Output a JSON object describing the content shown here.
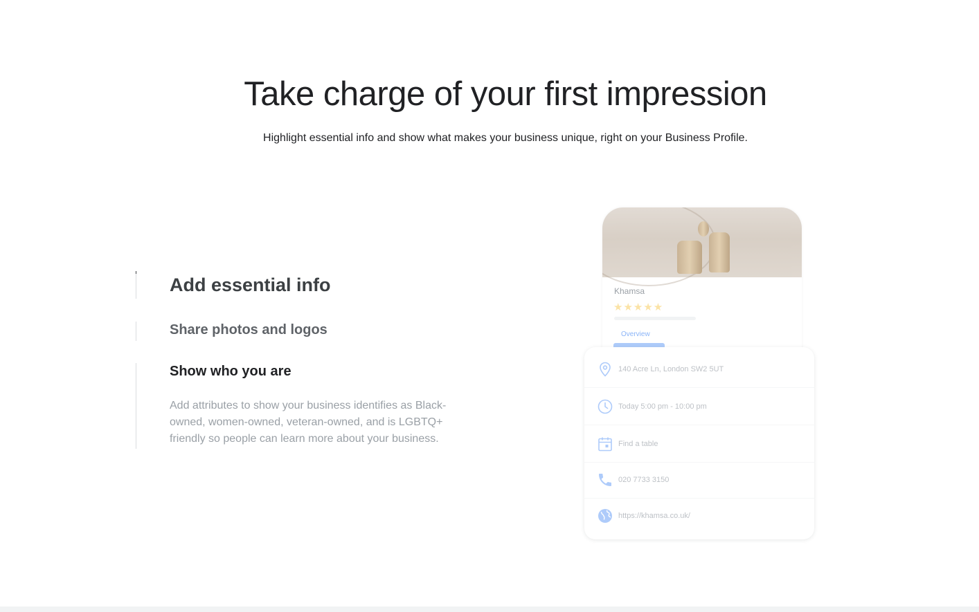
{
  "hero": {
    "title": "Take charge of your first impression",
    "subtitle": "Highlight essential info and show what makes your business unique, right on your Business Profile."
  },
  "features": [
    {
      "title": "Add essential info"
    },
    {
      "title": "Share photos and logos"
    },
    {
      "title": "Show who you are",
      "description": "Add attributes to show your business identifies as Black-owned, women-owned, veteran-owned, and is LGBTQ+ friendly so people can learn more about your business."
    }
  ],
  "mockup": {
    "business_name": "Khamsa",
    "stars": "★★★★★",
    "tab": "Overview",
    "rows": [
      {
        "icon": "location-pin-icon",
        "text": "140 Acre Ln, London SW2 5UT"
      },
      {
        "icon": "clock-icon",
        "text": "Today 5:00 pm - 10:00 pm"
      },
      {
        "icon": "calendar-icon",
        "text": "Find a table"
      },
      {
        "icon": "phone-icon",
        "text": "020 7733 3150"
      },
      {
        "icon": "globe-icon",
        "text": "https://khamsa.co.uk/"
      }
    ]
  },
  "colors": {
    "text_primary": "#202124",
    "text_muted": "#9aa0a6",
    "accent_blue": "#8ab4f8",
    "star_yellow": "#fbe3a6"
  }
}
